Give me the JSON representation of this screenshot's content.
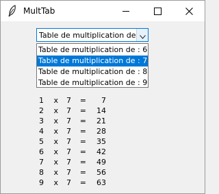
{
  "window": {
    "title": "MultTab",
    "icon": "feather-icon"
  },
  "combobox": {
    "value": "Table de multiplication de : 7"
  },
  "dropdown": {
    "options": [
      "Table de multiplication de : 6",
      "Table de multiplication de : 7",
      "Table de multiplication de : 8",
      "Table de multiplication de : 9"
    ],
    "selected_index": 1
  },
  "table": {
    "rows": [
      {
        "a": "1",
        "op": "x",
        "b": "7",
        "eq": "=",
        "r": "7"
      },
      {
        "a": "2",
        "op": "x",
        "b": "7",
        "eq": "=",
        "r": "14"
      },
      {
        "a": "3",
        "op": "x",
        "b": "7",
        "eq": "=",
        "r": "21"
      },
      {
        "a": "4",
        "op": "x",
        "b": "7",
        "eq": "=",
        "r": "28"
      },
      {
        "a": "5",
        "op": "x",
        "b": "7",
        "eq": "=",
        "r": "35"
      },
      {
        "a": "6",
        "op": "x",
        "b": "7",
        "eq": "=",
        "r": "42"
      },
      {
        "a": "7",
        "op": "x",
        "b": "7",
        "eq": "=",
        "r": "49"
      },
      {
        "a": "8",
        "op": "x",
        "b": "7",
        "eq": "=",
        "r": "56"
      },
      {
        "a": "9",
        "op": "x",
        "b": "7",
        "eq": "=",
        "r": "63"
      }
    ]
  },
  "colors": {
    "accent": "#0078d7",
    "window_bg": "#f0f0f0"
  }
}
